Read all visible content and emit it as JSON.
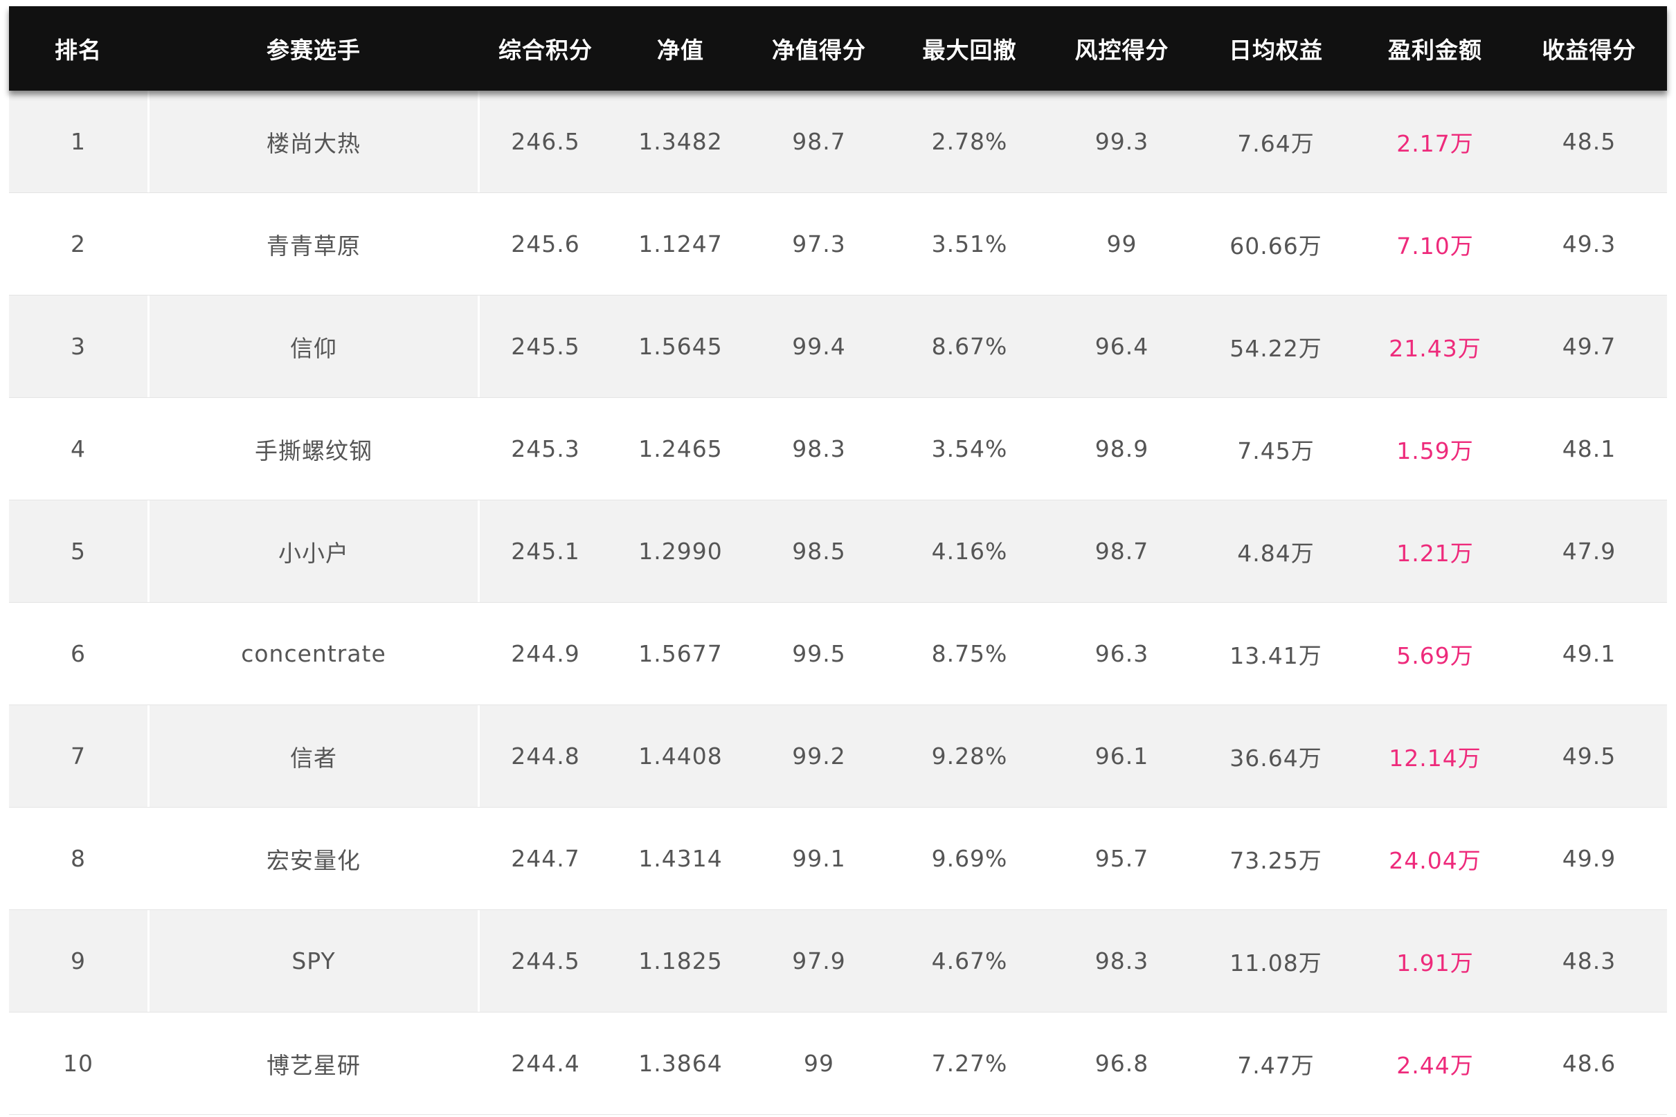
{
  "table": {
    "headers": [
      "排名",
      "参赛选手",
      "综合积分",
      "净值",
      "净值得分",
      "最大回撤",
      "风控得分",
      "日均权益",
      "盈利金额",
      "收益得分"
    ],
    "profit_color": "#ee2a7b",
    "header_bg": "#111111",
    "rows": [
      [
        "1",
        "楼尚大热",
        "246.5",
        "1.3482",
        "98.7",
        "2.78%",
        "99.3",
        "7.64万",
        "2.17万",
        "48.5"
      ],
      [
        "2",
        "青青草原",
        "245.6",
        "1.1247",
        "97.3",
        "3.51%",
        "99",
        "60.66万",
        "7.10万",
        "49.3"
      ],
      [
        "3",
        "信仰",
        "245.5",
        "1.5645",
        "99.4",
        "8.67%",
        "96.4",
        "54.22万",
        "21.43万",
        "49.7"
      ],
      [
        "4",
        "手撕螺纹钢",
        "245.3",
        "1.2465",
        "98.3",
        "3.54%",
        "98.9",
        "7.45万",
        "1.59万",
        "48.1"
      ],
      [
        "5",
        "小小户",
        "245.1",
        "1.2990",
        "98.5",
        "4.16%",
        "98.7",
        "4.84万",
        "1.21万",
        "47.9"
      ],
      [
        "6",
        "concentrate",
        "244.9",
        "1.5677",
        "99.5",
        "8.75%",
        "96.3",
        "13.41万",
        "5.69万",
        "49.1"
      ],
      [
        "7",
        "信者",
        "244.8",
        "1.4408",
        "99.2",
        "9.28%",
        "96.1",
        "36.64万",
        "12.14万",
        "49.5"
      ],
      [
        "8",
        "宏安量化",
        "244.7",
        "1.4314",
        "99.1",
        "9.69%",
        "95.7",
        "73.25万",
        "24.04万",
        "49.9"
      ],
      [
        "9",
        "SPY",
        "244.5",
        "1.1825",
        "97.9",
        "4.67%",
        "98.3",
        "11.08万",
        "1.91万",
        "48.3"
      ],
      [
        "10",
        "博艺星研",
        "244.4",
        "1.3864",
        "99",
        "7.27%",
        "96.8",
        "7.47万",
        "2.44万",
        "48.6"
      ]
    ]
  }
}
